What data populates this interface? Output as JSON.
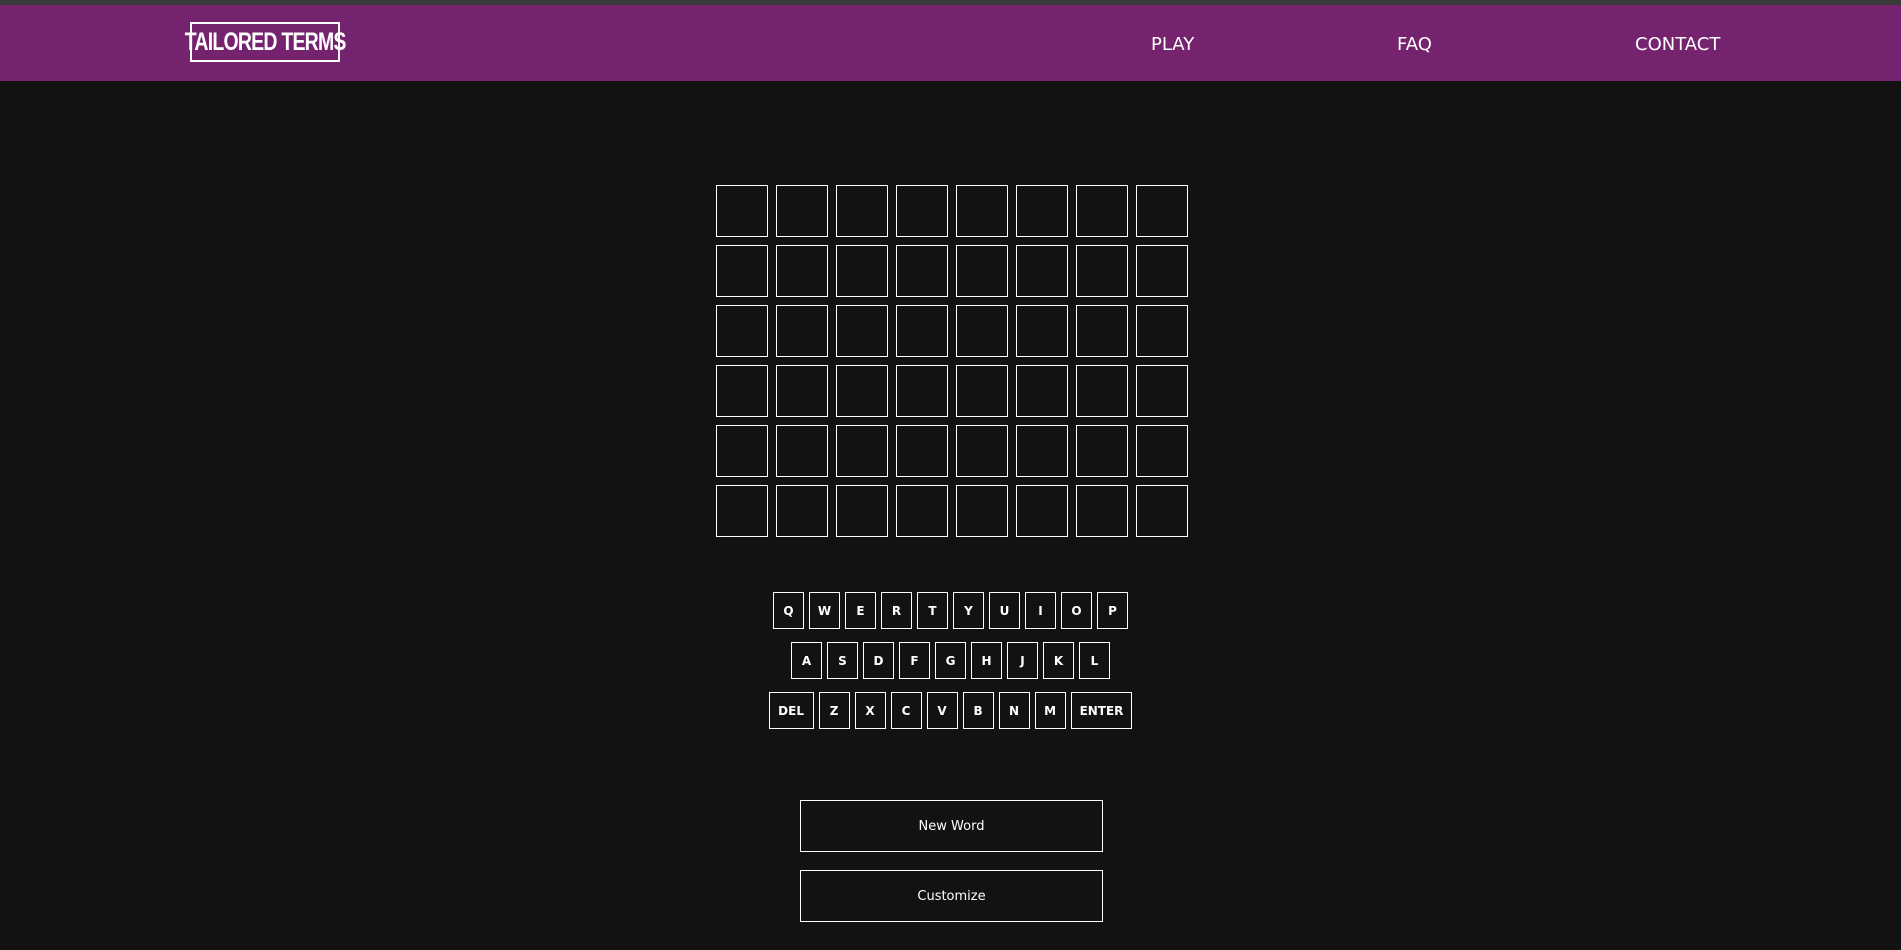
{
  "header": {
    "logo_text": "TAILORED TERMS",
    "nav": [
      "PLAY",
      "FAQ",
      "CONTACT"
    ]
  },
  "board": {
    "rows": 6,
    "cols": 8,
    "letters": [
      [
        "",
        "",
        "",
        "",
        "",
        "",
        "",
        ""
      ],
      [
        "",
        "",
        "",
        "",
        "",
        "",
        "",
        ""
      ],
      [
        "",
        "",
        "",
        "",
        "",
        "",
        "",
        ""
      ],
      [
        "",
        "",
        "",
        "",
        "",
        "",
        "",
        ""
      ],
      [
        "",
        "",
        "",
        "",
        "",
        "",
        "",
        ""
      ],
      [
        "",
        "",
        "",
        "",
        "",
        "",
        "",
        ""
      ]
    ]
  },
  "keyboard": {
    "rows": [
      [
        "Q",
        "W",
        "E",
        "R",
        "T",
        "Y",
        "U",
        "I",
        "O",
        "P"
      ],
      [
        "A",
        "S",
        "D",
        "F",
        "G",
        "H",
        "J",
        "K",
        "L"
      ],
      [
        "DEL",
        "Z",
        "X",
        "C",
        "V",
        "B",
        "N",
        "M",
        "ENTER"
      ]
    ]
  },
  "actions": {
    "new_word_label": "New Word",
    "customize_label": "Customize"
  },
  "colors": {
    "header_bg": "#76236f",
    "page_bg": "#121212",
    "border": "#ffffff"
  }
}
